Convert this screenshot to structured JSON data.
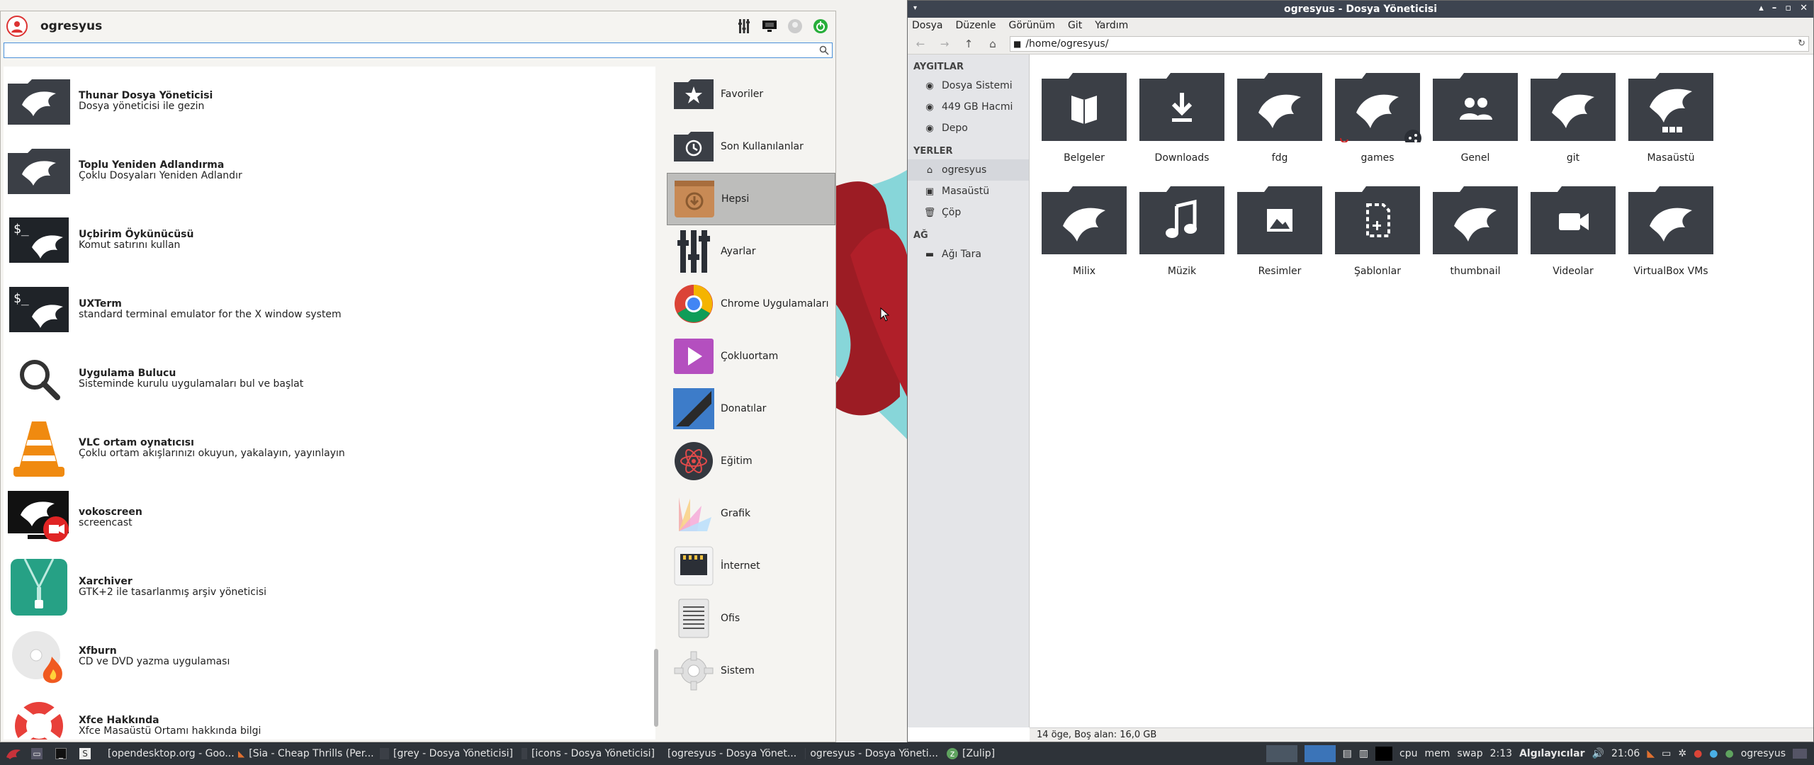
{
  "menu": {
    "user": "ogresyus",
    "search_placeholder": "",
    "apps": [
      {
        "name": "Thunar Dosya Yöneticisi",
        "desc": "Dosya yöneticisi ile gezin",
        "icon": "thunar-icon"
      },
      {
        "name": "Toplu Yeniden Adlandırma",
        "desc": "Çoklu Dosyaları Yeniden Adlandır",
        "icon": "bulk-rename-icon"
      },
      {
        "name": "Uçbirim Öykünücüsü",
        "desc": "Komut satırını kullan",
        "icon": "terminal-icon"
      },
      {
        "name": "UXTerm",
        "desc": "standard terminal emulator for the X window system",
        "icon": "uxterm-icon"
      },
      {
        "name": "Uygulama Bulucu",
        "desc": "Sisteminde kurulu uygulamaları bul ve başlat",
        "icon": "app-finder-icon"
      },
      {
        "name": "VLC ortam oynatıcısı",
        "desc": "Çoklu ortam akışlarınızı okuyun, yakalayın, yayınlayın",
        "icon": "vlc-icon"
      },
      {
        "name": "vokoscreen",
        "desc": "screencast",
        "icon": "vokoscreen-icon"
      },
      {
        "name": "Xarchiver",
        "desc": "GTK+2 ile tasarlanmış arşiv yöneticisi",
        "icon": "xarchiver-icon"
      },
      {
        "name": "Xfburn",
        "desc": "CD ve DVD yazma uygulaması",
        "icon": "xfburn-icon"
      },
      {
        "name": "Xfce Hakkında",
        "desc": "Xfce Masaüstü Ortamı hakkında bilgi",
        "icon": "xfce-about-icon"
      }
    ],
    "categories": [
      {
        "label": "Favoriler",
        "icon": "star-icon"
      },
      {
        "label": "Son Kullanılanlar",
        "icon": "history-icon"
      },
      {
        "label": "Hepsi",
        "icon": "all-apps-icon",
        "active": true
      },
      {
        "label": "Ayarlar",
        "icon": "settings-icon"
      },
      {
        "label": "Chrome Uygulamaları",
        "icon": "chrome-icon"
      },
      {
        "label": "Çokluortam",
        "icon": "multimedia-icon"
      },
      {
        "label": "Donatılar",
        "icon": "accessories-icon"
      },
      {
        "label": "Eğitim",
        "icon": "education-icon"
      },
      {
        "label": "Grafik",
        "icon": "graphics-icon"
      },
      {
        "label": "İnternet",
        "icon": "internet-icon"
      },
      {
        "label": "Ofis",
        "icon": "office-icon"
      },
      {
        "label": "Sistem",
        "icon": "system-icon"
      }
    ]
  },
  "fm": {
    "title": "ogresyus - Dosya Yöneticisi",
    "menus": [
      "Dosya",
      "Düzenle",
      "Görünüm",
      "Git",
      "Yardım"
    ],
    "path": "/home/ogresyus/",
    "sidebar": {
      "devices_header": "AYGITLAR",
      "devices": [
        "Dosya Sistemi",
        "449 GB Hacmi",
        "Depo"
      ],
      "places_header": "YERLER",
      "places": [
        "ogresyus",
        "Masaüstü",
        "Çöp"
      ],
      "network_header": "AĞ",
      "network": [
        "Ağı Tara"
      ]
    },
    "folders": [
      [
        "Belgeler",
        "Downloads",
        "fdg",
        "games",
        "Genel",
        "git",
        "Masaüstü"
      ],
      [
        "Milix",
        "Müzik",
        "Resimler",
        "Şablonlar",
        "thumbnail",
        "Videolar",
        "VirtualBox VMs"
      ]
    ],
    "status": "14 öge, Boş alan: 16,0 GB"
  },
  "taskbar": {
    "tasks": [
      "[opendesktop.org - Goo...",
      "[Sia - Cheap Thrills (Per...",
      "[grey - Dosya Yöneticisi]",
      "[icons - Dosya Yöneticisi]",
      "[ogresyus - Dosya Yönet...",
      "ogresyus - Dosya Yöneti...",
      "[Zulip]"
    ],
    "tray": {
      "cpu": "cpu",
      "mem": "mem",
      "swap": "swap",
      "battery": "2:13",
      "sensors": "Algılayıcılar",
      "clock": "21:06",
      "user": "ogresyus"
    }
  },
  "colors": {
    "folder": "#3b3f46",
    "accent": "#3b74b8",
    "brand_red": "#9c1c24",
    "teal": "#30c0c8"
  }
}
